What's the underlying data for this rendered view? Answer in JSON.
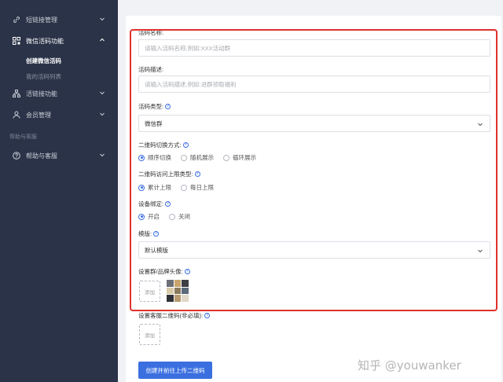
{
  "sidebar": {
    "items": [
      {
        "label": "短链接管理",
        "icon": "link-icon"
      },
      {
        "label": "微信活码功能",
        "icon": "qrcode-icon"
      },
      {
        "label": "活链接功能",
        "icon": "sitemap-icon"
      },
      {
        "label": "会员管理",
        "icon": "user-icon"
      }
    ],
    "sub_items": [
      {
        "label": "创建微信活码",
        "active": true
      },
      {
        "label": "我的活码列表",
        "active": false
      }
    ],
    "group_title": "帮助与客服",
    "help_item": {
      "label": "帮助与客服",
      "icon": "question-circle-icon"
    }
  },
  "form": {
    "name": {
      "label": "活码名称:",
      "placeholder": "请输入活码名称,例如:XXX活动群"
    },
    "desc": {
      "label": "活码描述:",
      "placeholder": "请输入活码描述,例如:进群领取福利"
    },
    "type": {
      "label": "活码类型:",
      "value": "微信群"
    },
    "switch_mode": {
      "label": "二维码切换方式:",
      "options": [
        "顺序切换",
        "随机展示",
        "循环展示"
      ],
      "selected": 0
    },
    "limit_type": {
      "label": "二维码访问上限类型:",
      "options": [
        "累计上限",
        "每日上限"
      ],
      "selected": 0
    },
    "device_bind": {
      "label": "设备绑定:",
      "options": [
        "开启",
        "关闭"
      ],
      "selected": 0
    },
    "template": {
      "label": "模版:",
      "value": "默认模版"
    },
    "avatar": {
      "label": "设置群/品牌头像:",
      "upload": "添加"
    },
    "service_qr": {
      "label": "设置客服二维码(非必填):",
      "upload": "添加"
    },
    "submit": "创建并前往上传二维码"
  },
  "watermark": "知乎 @youwanker",
  "colors": {
    "accent": "#3b6fe0",
    "sidebar_bg": "#2a3347",
    "highlight": "#e0312b"
  }
}
